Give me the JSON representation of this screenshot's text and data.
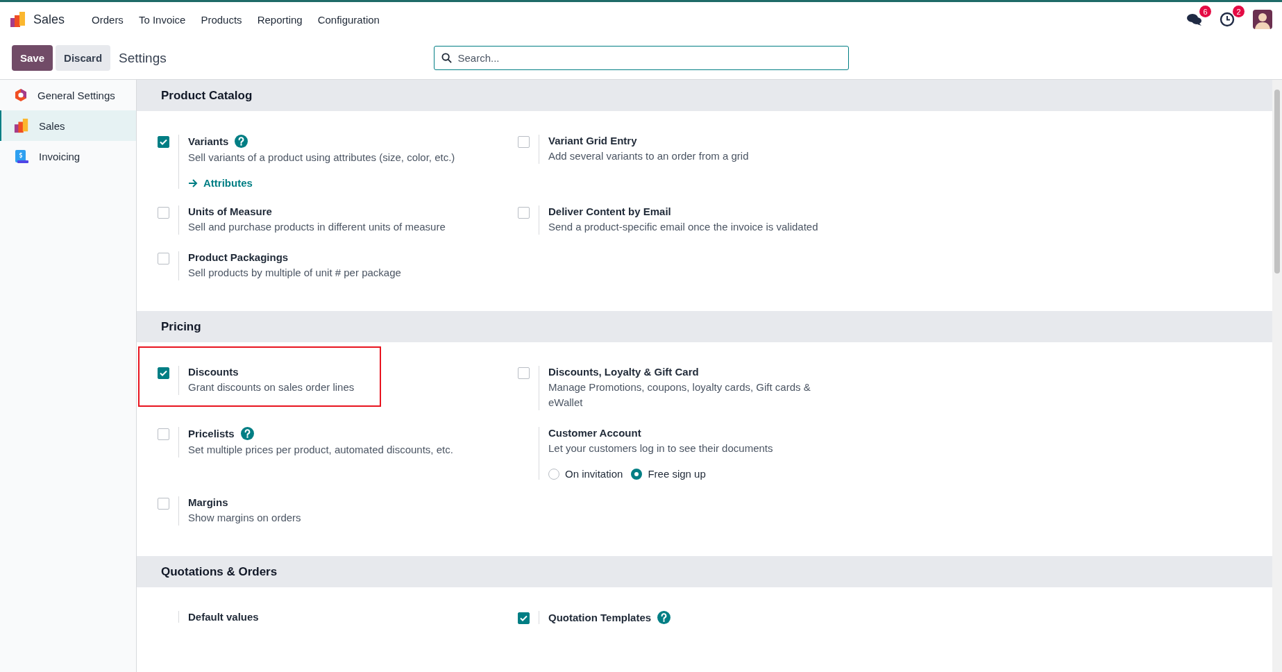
{
  "app": {
    "name": "Sales"
  },
  "menu": [
    "Orders",
    "To Invoice",
    "Products",
    "Reporting",
    "Configuration"
  ],
  "notifications": [
    {
      "kind": "messages",
      "count": "6"
    },
    {
      "kind": "activities",
      "count": "2"
    }
  ],
  "control_panel": {
    "buttons": [
      {
        "label": "Save",
        "kind": "primary"
      },
      {
        "label": "Discard",
        "kind": "secondary"
      }
    ],
    "title": "Settings"
  },
  "search": {
    "placeholder": "Search..."
  },
  "sidebar": {
    "items": [
      {
        "label": "General Settings",
        "kind": "general",
        "selected": false
      },
      {
        "label": "Sales",
        "kind": "sales",
        "selected": true
      },
      {
        "label": "Invoicing",
        "kind": "invoicing",
        "selected": false
      }
    ]
  },
  "sections": [
    {
      "title": "Product Catalog",
      "settings": [
        {
          "kind": "checkbox",
          "title": "Variants",
          "checked": true,
          "help": true,
          "highlighted": false,
          "description": "Sell variants of a product using attributes (size, color, etc.)",
          "link": "Attributes"
        },
        {
          "kind": "checkbox",
          "title": "Variant Grid Entry",
          "checked": false,
          "help": false,
          "highlighted": false,
          "description": "Add several variants to an order from a grid"
        },
        {
          "kind": "checkbox",
          "title": "Units of Measure",
          "checked": false,
          "help": false,
          "highlighted": false,
          "description": "Sell and purchase products in different units of measure"
        },
        {
          "kind": "checkbox",
          "title": "Deliver Content by Email",
          "checked": false,
          "help": false,
          "highlighted": false,
          "description": "Send a product-specific email once the invoice is validated"
        },
        {
          "kind": "checkbox",
          "title": "Product Packagings",
          "checked": false,
          "help": false,
          "highlighted": false,
          "description": "Sell products by multiple of unit # per package"
        }
      ]
    },
    {
      "title": "Pricing",
      "settings": [
        {
          "kind": "checkbox",
          "title": "Discounts",
          "checked": true,
          "help": false,
          "highlighted": true,
          "description": "Grant discounts on sales order lines"
        },
        {
          "kind": "checkbox",
          "title": "Discounts, Loyalty & Gift Card",
          "checked": false,
          "help": false,
          "highlighted": false,
          "description": "Manage Promotions, coupons, loyalty cards, Gift cards & eWallet"
        },
        {
          "kind": "checkbox",
          "title": "Pricelists",
          "checked": false,
          "help": true,
          "highlighted": false,
          "description": "Set multiple prices per product, automated discounts, etc."
        },
        {
          "kind": "plain",
          "title": "Customer Account",
          "help": false,
          "highlighted": false,
          "description": "Let your customers log in to see their documents",
          "options": [
            {
              "label": "On invitation",
              "selected": false
            },
            {
              "label": "Free sign up",
              "selected": true
            }
          ]
        },
        {
          "kind": "checkbox",
          "title": "Margins",
          "checked": false,
          "help": false,
          "highlighted": false,
          "description": "Show margins on orders"
        }
      ]
    },
    {
      "title": "Quotations & Orders",
      "settings": [
        {
          "kind": "plain",
          "title": "Default values",
          "help": false,
          "highlighted": false
        },
        {
          "kind": "checkbox",
          "title": "Quotation Templates",
          "checked": true,
          "help": true,
          "highlighted": false
        }
      ]
    }
  ]
}
